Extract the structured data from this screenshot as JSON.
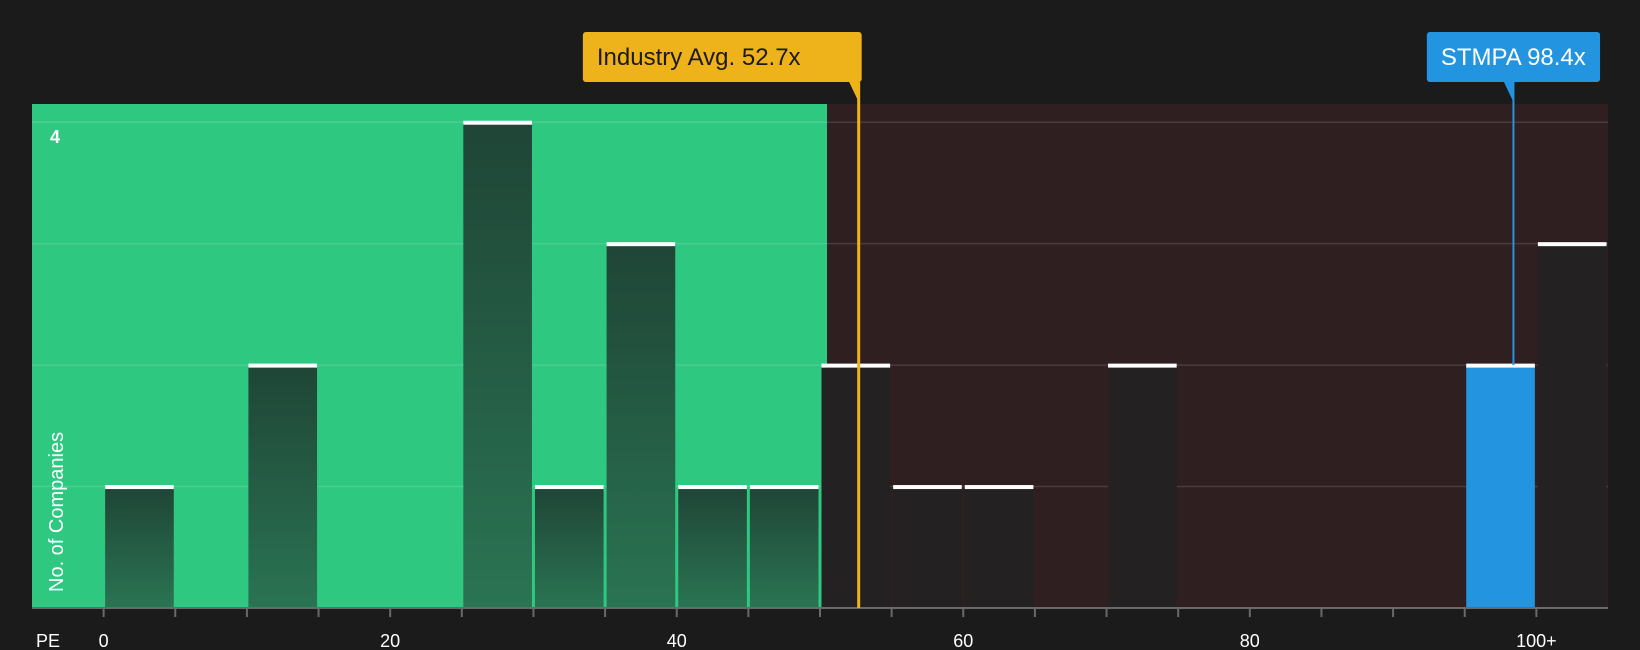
{
  "chart_data": {
    "type": "bar",
    "title": "",
    "xlabel": "PE",
    "ylabel": "No. of Companies",
    "xlim": [
      -5,
      105
    ],
    "ylim": [
      0,
      4.15
    ],
    "x_ticks": [
      0,
      20,
      40,
      60,
      80,
      100
    ],
    "x_tick_labels": [
      "0",
      "20",
      "40",
      "60",
      "80",
      "100+"
    ],
    "minor_ticks": [
      5,
      10,
      15,
      25,
      30,
      35,
      45,
      50,
      55,
      65,
      70,
      75,
      85,
      90,
      95
    ],
    "y_gridlines": [
      1,
      2,
      3,
      4
    ],
    "y_max_label": "4",
    "bin_width": 5,
    "bins": [
      {
        "x": 0,
        "count": 1
      },
      {
        "x": 10,
        "count": 2
      },
      {
        "x": 25,
        "count": 4
      },
      {
        "x": 30,
        "count": 1
      },
      {
        "x": 35,
        "count": 3
      },
      {
        "x": 40,
        "count": 1
      },
      {
        "x": 45,
        "count": 1
      },
      {
        "x": 50,
        "count": 2
      },
      {
        "x": 55,
        "count": 1
      },
      {
        "x": 60,
        "count": 1
      },
      {
        "x": 70,
        "count": 2
      },
      {
        "x": 95,
        "count": 2,
        "highlight": true
      },
      {
        "x": 100,
        "count": 3
      }
    ],
    "regions": [
      {
        "name": "below-average",
        "from": -5,
        "to": 50.5,
        "color": "#2ec880"
      },
      {
        "name": "above-average",
        "from": 50.5,
        "to": 105,
        "color": "#2f1f20"
      }
    ],
    "markers": [
      {
        "name": "industry-avg",
        "label": "Industry Avg. 52.7x",
        "value": 52.7,
        "color": "#eeb21b",
        "text_color": "#1b1b1b"
      },
      {
        "name": "company",
        "label": "STMPA 98.4x",
        "value": 98.4,
        "color": "#2394e0",
        "text_color": "#ffffff"
      }
    ],
    "colors": {
      "background": "#1b1b1b",
      "bar_in_green": "#23493a",
      "bar_in_dark": "#242122",
      "bar_highlight": "#2394e0",
      "bar_cap": "#ffffff",
      "grid": "#4a4a4a",
      "axis": "#6a6a6a"
    }
  }
}
